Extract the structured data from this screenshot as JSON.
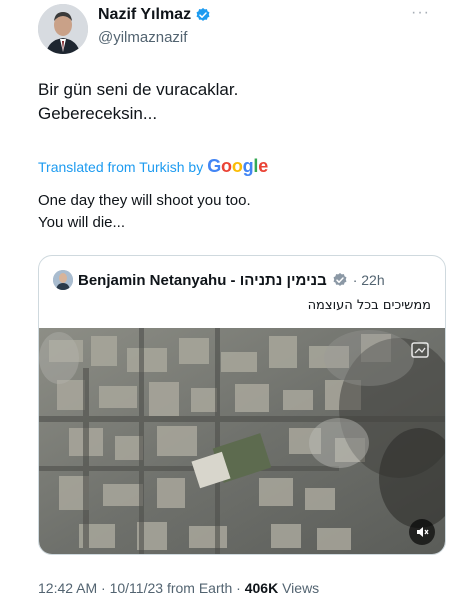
{
  "author": {
    "display_name": "Nazif Yılmaz",
    "handle": "@yilmaznazif",
    "verified": true
  },
  "tweet": {
    "text_lines": [
      "Bir gün seni de vuracaklar.",
      "Gebereceksin..."
    ],
    "translated_label": "Translated from Turkish by",
    "translator": "Google",
    "translation_lines": [
      "One day they will shoot you too.",
      "You will die..."
    ]
  },
  "quoted": {
    "author_name": "Benjamin Netanyahu - בנימין נתניהו",
    "time": "· 22h",
    "text": "ממשיכים בכל העוצמה",
    "media": "aerial-video-thumbnail"
  },
  "meta": {
    "timestamp": "12:42 AM · 10/11/23 from Earth · ",
    "views_count": "406K",
    "views_label": "Views"
  },
  "colors": {
    "link": "#1d9bf0",
    "verified": "#1d9bf0",
    "text": "#0f1419",
    "secondary": "#536471",
    "border": "#cfd9de"
  }
}
